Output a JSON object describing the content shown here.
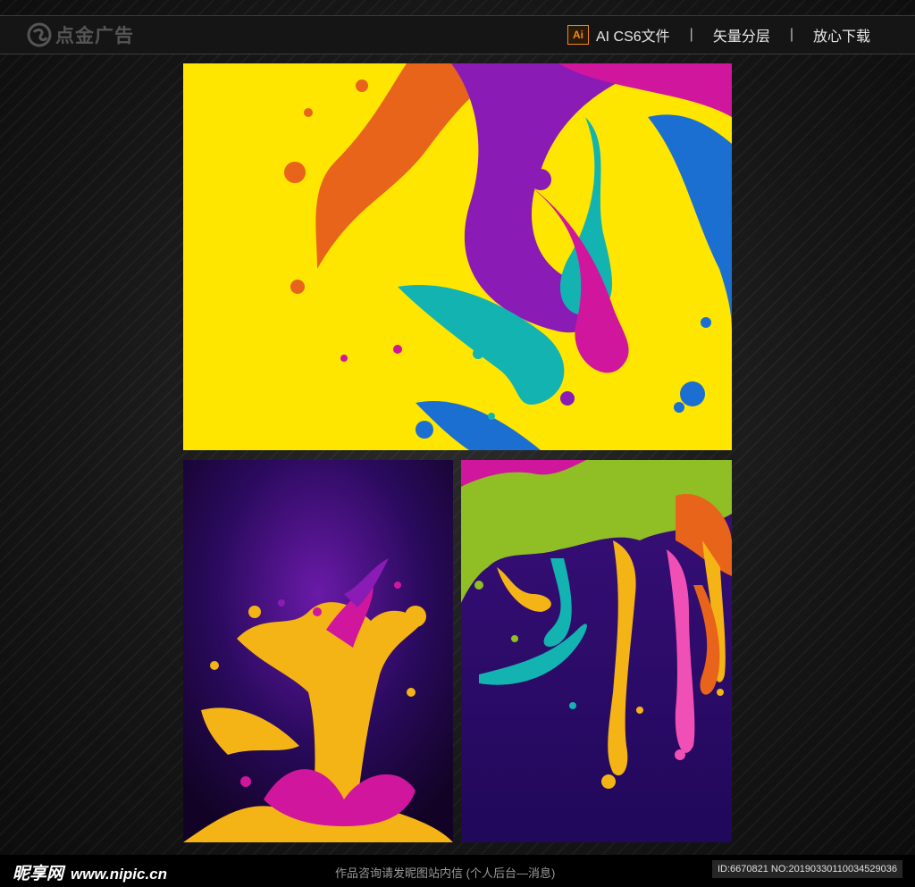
{
  "header": {
    "logo_text": "点金广告",
    "ai_badge": "Ai",
    "format": "AI CS6文件",
    "separator": "|",
    "layers": "矢量分层",
    "download": "放心下载"
  },
  "footer": {
    "brand": "昵享网",
    "url": "www.nipic.cn",
    "note": "作品咨询请发昵图站内信 (个人后台—消息)",
    "id_text": "ID:6670821 NO:20190330110034529036"
  },
  "colors": {
    "yellow_bg": "#ffe600",
    "purple_bg": "#2a0a5e",
    "orange": "#e8641a",
    "magenta": "#d0169c",
    "violet": "#8a1bb5",
    "cyan": "#12b3b0",
    "blue": "#1b6fd0",
    "lime": "#8fbf25",
    "gold": "#f5b416",
    "pink": "#f04fb5"
  }
}
